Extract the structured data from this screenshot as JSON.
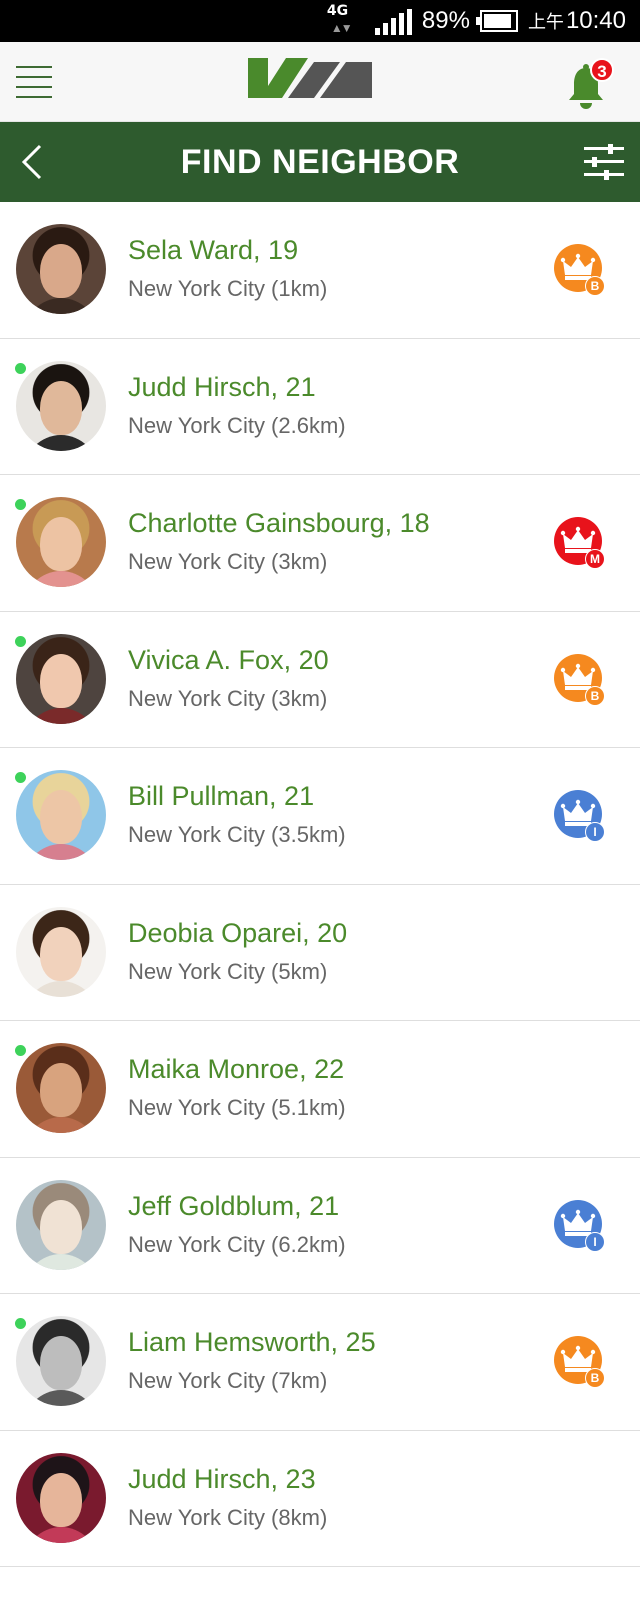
{
  "status_bar": {
    "network": "4G",
    "battery": "89%",
    "ampm": "上午",
    "time": "10:40",
    "icons": [
      "network-4g-icon",
      "signal-icon",
      "battery-icon"
    ]
  },
  "header": {
    "menu_icon": "hamburger-menu-icon",
    "logo": "app-logo",
    "notification_icon": "bell-icon",
    "notification_count": "3",
    "brand_color": "#4a8a2c"
  },
  "title_bar": {
    "back_icon": "chevron-left-icon",
    "title": "FIND NEIGHBOR",
    "filter_icon": "sliders-icon",
    "bar_color": "#2e5b2e"
  },
  "badge_colors": {
    "B": "#f5891f",
    "M": "#e8131b",
    "I": "#4a7fd4"
  },
  "neighbors": [
    {
      "name": "Sela Ward, 19",
      "location": "New York City (1km)",
      "online": false,
      "badge": "B",
      "avatar": {
        "hair": "#2a1a12",
        "skin": "#d9a88a",
        "cloth": "#3a2a22",
        "bg": "#5b4438"
      }
    },
    {
      "name": "Judd Hirsch, 21",
      "location": "New York City (2.6km)",
      "online": true,
      "badge": "",
      "avatar": {
        "hair": "#1a1410",
        "skin": "#e0b89a",
        "cloth": "#2b2b2b",
        "bg": "#e8e6e2"
      }
    },
    {
      "name": "Charlotte Gainsbourg, 18",
      "location": "New York City (3km)",
      "online": true,
      "badge": "M",
      "avatar": {
        "hair": "#c89a55",
        "skin": "#edc3a3",
        "cloth": "#e3928f",
        "bg": "#b87a4c"
      }
    },
    {
      "name": "Vivica A. Fox, 20",
      "location": "New York City (3km)",
      "online": true,
      "badge": "B",
      "avatar": {
        "hair": "#3a2418",
        "skin": "#f0c8ae",
        "cloth": "#7a2a2a",
        "bg": "#4e443f"
      }
    },
    {
      "name": "Bill Pullman, 21",
      "location": "New York City (3.5km)",
      "online": true,
      "badge": "I",
      "avatar": {
        "hair": "#e8d49a",
        "skin": "#edc6a6",
        "cloth": "#d67f8f",
        "bg": "#8fc6e8"
      }
    },
    {
      "name": "Deobia Oparei, 20",
      "location": "New York City (5km)",
      "online": false,
      "badge": "",
      "avatar": {
        "hair": "#3c2618",
        "skin": "#f1d2bc",
        "cloth": "#e8e0d6",
        "bg": "#f4f2ef"
      }
    },
    {
      "name": "Maika Monroe, 22",
      "location": "New York City (5.1km)",
      "online": true,
      "badge": "",
      "avatar": {
        "hair": "#5a2e1a",
        "skin": "#d8a37e",
        "cloth": "#b86a4a",
        "bg": "#9a5a38"
      }
    },
    {
      "name": "Jeff Goldblum, 21",
      "location": "New York City (6.2km)",
      "online": false,
      "badge": "I",
      "avatar": {
        "hair": "#9a8a7a",
        "skin": "#f0e2d4",
        "cloth": "#dfe8e0",
        "bg": "#b4c2c8"
      }
    },
    {
      "name": "Liam Hemsworth, 25",
      "location": "New York City (7km)",
      "online": true,
      "badge": "B",
      "avatar": {
        "hair": "#2a2a2a",
        "skin": "#bdbdbd",
        "cloth": "#5a5a5a",
        "bg": "#e6e6e6"
      }
    },
    {
      "name": "Judd Hirsch, 23",
      "location": "New York City (8km)",
      "online": false,
      "badge": "",
      "avatar": {
        "hair": "#1e1418",
        "skin": "#e6b59a",
        "cloth": "#c23a58",
        "bg": "#7a1a2e"
      }
    }
  ]
}
